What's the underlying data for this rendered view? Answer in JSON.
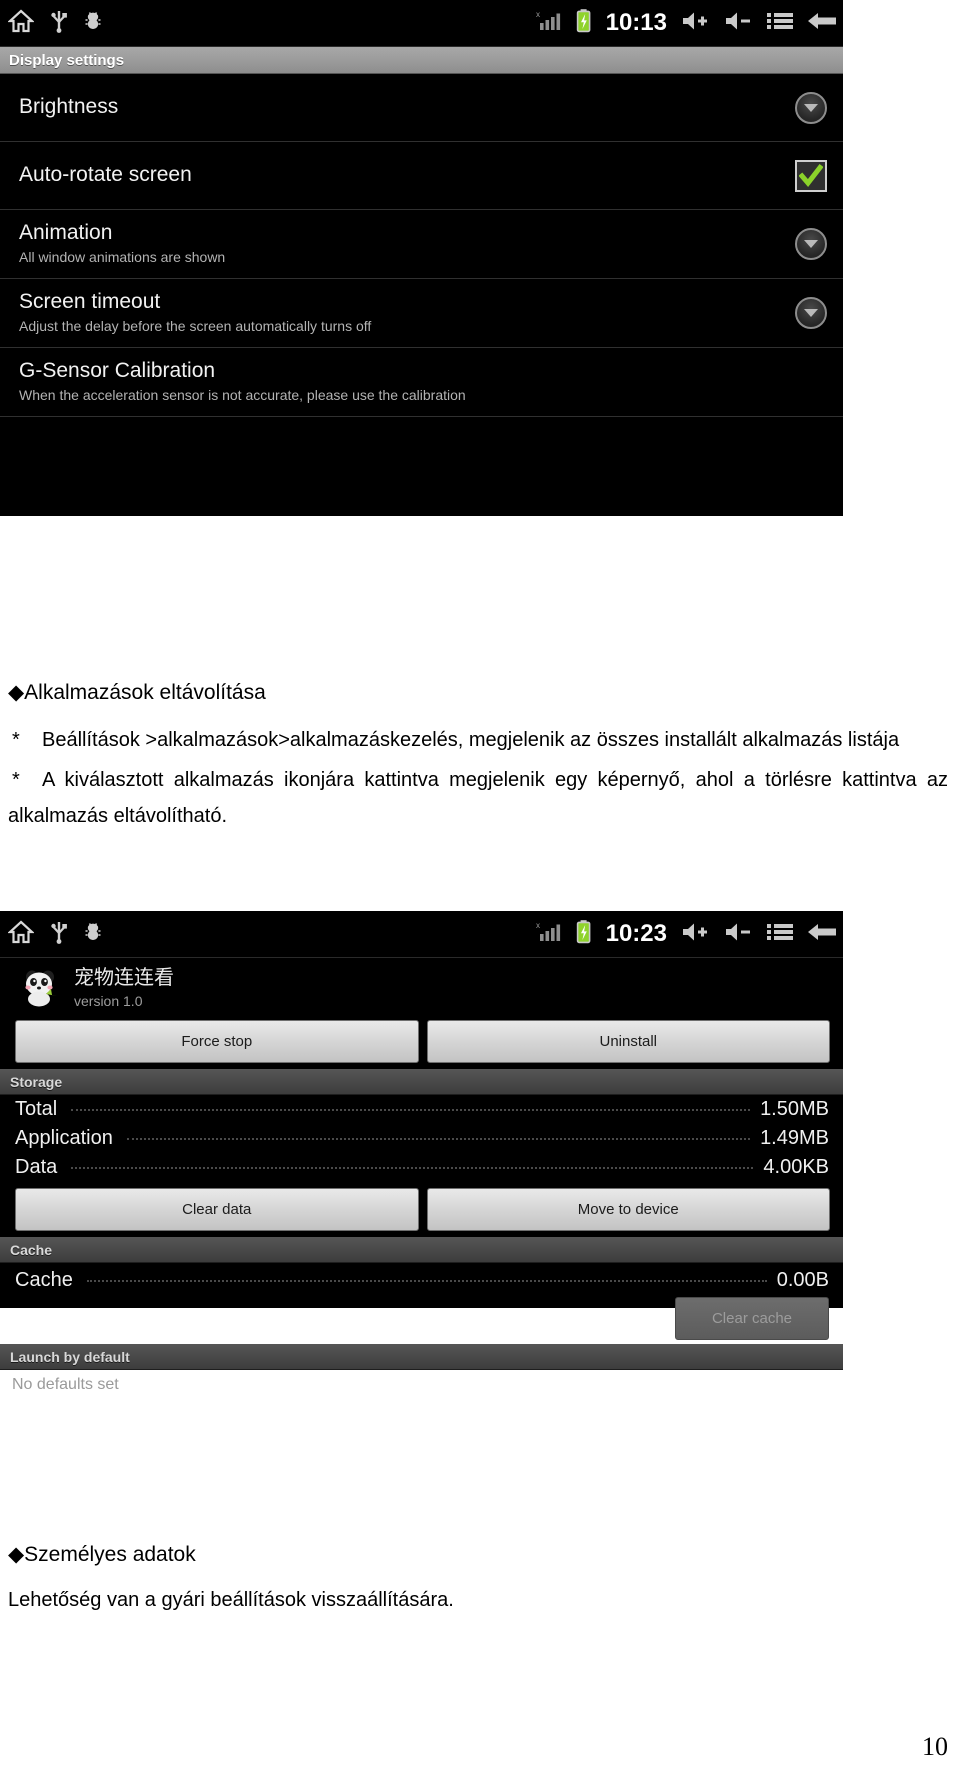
{
  "document": {
    "page_number": "10",
    "section1_heading": "◆Alkalmazások eltávolítása",
    "bullet1_marker": "*",
    "bullet1_text": "Beállítások >alkalmazások>alkalmazáskezelés, megjelenik az összes installált alkalmazás listája",
    "bullet2_marker": "*",
    "bullet2_text": "A kiválasztott alkalmazás ikonjára kattintva megjelenik egy képernyő, ahol a törlésre kattintva az alkalmazás eltávolítható.",
    "section2_heading": "◆Személyes adatok",
    "section2_text": "Lehetőség van a gyári beállítások visszaállítására."
  },
  "display_settings_screenshot": {
    "statusbar": {
      "time": "10:13",
      "left_icons": [
        "home-icon",
        "usb-icon",
        "android-debug-icon"
      ],
      "right_icons": [
        "signal-bars-icon",
        "battery-charging-icon",
        "volume-up-icon",
        "volume-down-icon",
        "menu-icon",
        "back-icon"
      ]
    },
    "title": "Display settings",
    "items": [
      {
        "title": "Brightness",
        "summary": "",
        "widget": "dropdown"
      },
      {
        "title": "Auto-rotate screen",
        "summary": "",
        "widget": "checkbox-checked"
      },
      {
        "title": "Animation",
        "summary": "All window animations are shown",
        "widget": "dropdown"
      },
      {
        "title": "Screen timeout",
        "summary": "Adjust the delay before the screen automatically turns off",
        "widget": "dropdown"
      },
      {
        "title": "G-Sensor Calibration",
        "summary": "When the acceleration sensor is not accurate, please use the calibration",
        "widget": "none"
      }
    ]
  },
  "app_info_screenshot": {
    "statusbar": {
      "time": "10:23",
      "left_icons": [
        "home-icon",
        "usb-icon",
        "android-debug-icon"
      ],
      "right_icons": [
        "signal-bars-icon",
        "battery-charging-icon",
        "volume-up-icon",
        "volume-down-icon",
        "menu-icon",
        "back-icon"
      ]
    },
    "app_name": "宠物连连看",
    "app_version": "version 1.0",
    "force_stop_label": "Force stop",
    "uninstall_label": "Uninstall",
    "storage_header": "Storage",
    "storage_rows": [
      {
        "label": "Total",
        "value": "1.50MB"
      },
      {
        "label": "Application",
        "value": "1.49MB"
      },
      {
        "label": "Data",
        "value": "4.00KB"
      }
    ],
    "clear_data_label": "Clear data",
    "move_to_device_label": "Move to device",
    "cache_header": "Cache",
    "cache_row": {
      "label": "Cache",
      "value": "0.00B"
    },
    "clear_cache_label": "Clear cache",
    "launch_by_default_header": "Launch by default",
    "no_defaults_text": "No defaults set"
  },
  "colors": {
    "accent_green": "#8bd22a",
    "title_bar_grey": "#9a9a9a",
    "screen_black": "#000000"
  }
}
